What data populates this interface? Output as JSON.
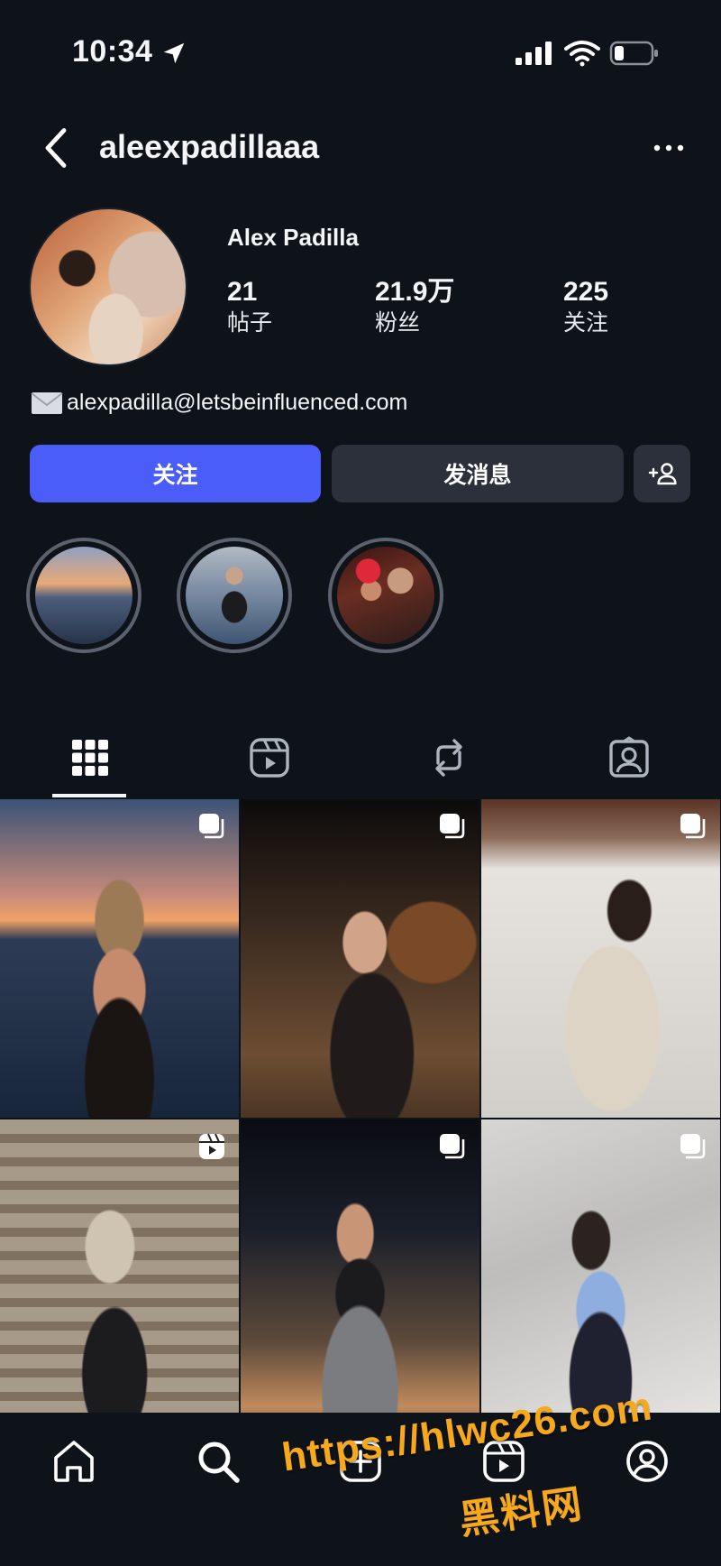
{
  "status_bar": {
    "time": "10:34"
  },
  "header": {
    "username": "aleexpadillaaa"
  },
  "profile": {
    "display_name": "Alex Padilla",
    "stats": [
      {
        "value": "21",
        "label": "帖子"
      },
      {
        "value": "21.9万",
        "label": "粉丝"
      },
      {
        "value": "225",
        "label": "关注"
      }
    ],
    "email": "alexpadilla@letsbeinfluenced.com"
  },
  "actions": {
    "follow_label": "关注",
    "message_label": "发消息"
  },
  "highlights": [
    {
      "icon": "sunset-beach-photo"
    },
    {
      "icon": "sea-portrait-photo"
    },
    {
      "icon": "group-photo"
    }
  ],
  "tabs": [
    {
      "name": "posts-grid",
      "icon": "grid-icon",
      "selected": true
    },
    {
      "name": "reels",
      "icon": "reels-icon",
      "selected": false
    },
    {
      "name": "reposts",
      "icon": "repost-icon",
      "selected": false
    },
    {
      "name": "tagged",
      "icon": "tagged-icon",
      "selected": false
    }
  ],
  "posts": [
    {
      "type": "carousel"
    },
    {
      "type": "carousel"
    },
    {
      "type": "carousel"
    },
    {
      "type": "reel"
    },
    {
      "type": "carousel"
    },
    {
      "type": "carousel"
    }
  ],
  "bottom_nav": [
    "home-icon",
    "search-icon",
    "create-icon",
    "reels-icon",
    "profile-icon"
  ],
  "watermark": {
    "url": "https://hlwc26.com",
    "name": "黑料网"
  },
  "colors": {
    "background": "#0e1219",
    "accent": "#4a5df9",
    "secondary_button": "#2b303a",
    "watermark": "#f7a81b"
  }
}
